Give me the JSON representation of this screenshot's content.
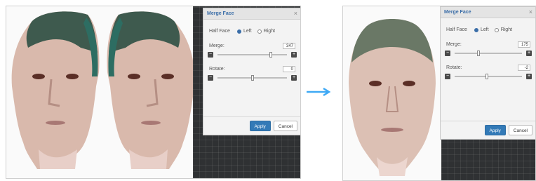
{
  "before": {
    "dialog": {
      "title": "Merge Face",
      "close_glyph": "×",
      "half_face_label": "Half Face",
      "option_left": "Left",
      "option_right": "Right",
      "selected_option": "Left",
      "merge_label": "Merge:",
      "merge_value": "347",
      "merge_slider_fraction": 0.77,
      "rotate_label": "Rotate:",
      "rotate_value": "0",
      "rotate_slider_fraction": 0.5,
      "minus_glyph": "−",
      "plus_glyph": "+",
      "apply_label": "Apply",
      "cancel_label": "Cancel"
    }
  },
  "after": {
    "dialog": {
      "title": "Merge Face",
      "close_glyph": "×",
      "half_face_label": "Half Face",
      "option_left": "Left",
      "option_right": "Right",
      "selected_option": "Left",
      "merge_label": "Merge:",
      "merge_value": "175",
      "merge_slider_fraction": 0.35,
      "rotate_label": "Rotate:",
      "rotate_value": "-2",
      "rotate_slider_fraction": 0.48,
      "minus_glyph": "−",
      "plus_glyph": "+",
      "apply_label": "Apply",
      "cancel_label": "Cancel"
    }
  },
  "colors": {
    "accent": "#3b6ea8",
    "arrow": "#3fa9f5",
    "apply_button": "#337ab7",
    "workspace_dark": "#2f3133"
  }
}
